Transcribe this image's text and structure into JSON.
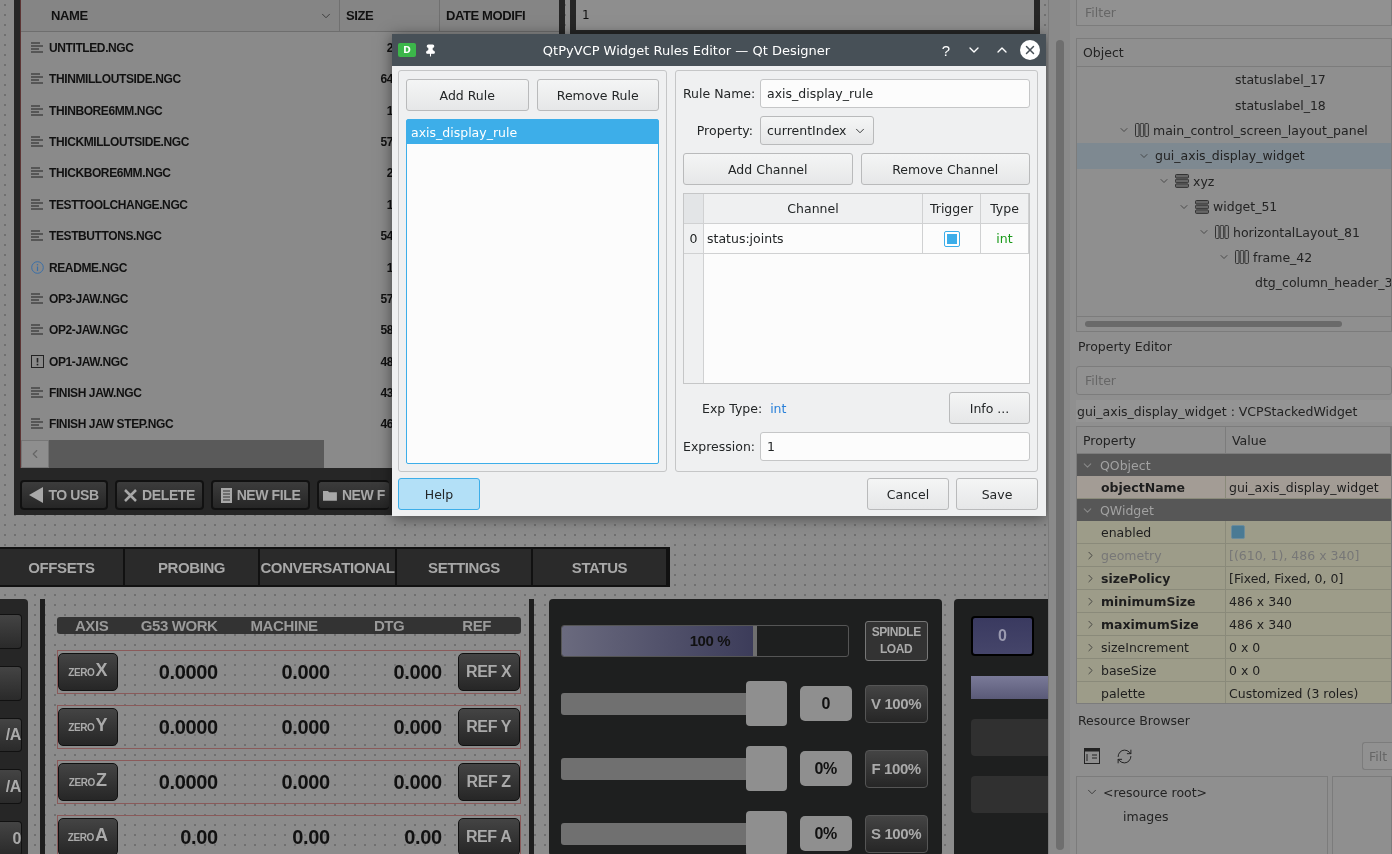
{
  "canvas": {
    "file_browser": {
      "columns": [
        {
          "label": "NAME",
          "sorted": true
        },
        {
          "label": "SIZE",
          "sorted": false
        },
        {
          "label": "DATE MODIFI",
          "sorted": false
        }
      ],
      "rows": [
        {
          "kind": "text",
          "name": "UNTITLED.NGC",
          "size": "2"
        },
        {
          "kind": "text",
          "name": "THINMILLOUTSIDE.NGC",
          "size": "64"
        },
        {
          "kind": "text",
          "name": "THINBORE6MM.NGC",
          "size": "1"
        },
        {
          "kind": "text",
          "name": "THICKMILLOUTSIDE.NGC",
          "size": "57"
        },
        {
          "kind": "text",
          "name": "THICKBORE6MM.NGC",
          "size": "2"
        },
        {
          "kind": "text",
          "name": "TESTTOOLCHANGE.NGC",
          "size": "1"
        },
        {
          "kind": "text",
          "name": "TESTBUTTONS.NGC",
          "size": "54"
        },
        {
          "kind": "info",
          "name": "README.NGC",
          "size": "1"
        },
        {
          "kind": "text",
          "name": "OP3-JAW.NGC",
          "size": "57"
        },
        {
          "kind": "text",
          "name": "OP2-JAW.NGC",
          "size": "58"
        },
        {
          "kind": "warning",
          "name": "OP1-JAW.NGC",
          "size": "48"
        },
        {
          "kind": "text",
          "name": "FINISH JAW.NGC",
          "size": "43"
        },
        {
          "kind": "text",
          "name": "FINISH JAW STEP.NGC",
          "size": "46"
        }
      ],
      "buttons": [
        {
          "kind": "back",
          "label": "TO USB"
        },
        {
          "kind": "delete",
          "label": "DELETE"
        },
        {
          "kind": "file",
          "label": "NEW FILE"
        },
        {
          "kind": "folder",
          "label": "NEW F"
        }
      ]
    },
    "editor_panel": {
      "text": "1"
    },
    "tabs": [
      "OFFSETS",
      "PROBING",
      "CONVERSATIONAL",
      "SETTINGS",
      "STATUS"
    ],
    "side_buttons": [
      {
        "kind": "blank"
      },
      {
        "kind": "blank"
      },
      {
        "kind": "text",
        "label": "/A"
      },
      {
        "kind": "text",
        "label": "/A"
      },
      {
        "kind": "text",
        "label": "0"
      }
    ],
    "dro": {
      "columns": [
        "AXIS",
        "G53 WORK",
        "MACHINE",
        "DTG",
        "REF"
      ],
      "rows": [
        {
          "zero": "ZERO",
          "axis": "X",
          "work": "0.0000",
          "machine": "0.000",
          "dtg": "0.000",
          "ref": "REF X"
        },
        {
          "zero": "ZERO",
          "axis": "Y",
          "work": "0.0000",
          "machine": "0.000",
          "dtg": "0.000",
          "ref": "REF Y"
        },
        {
          "zero": "ZERO",
          "axis": "Z",
          "work": "0.0000",
          "machine": "0.000",
          "dtg": "0.000",
          "ref": "REF Z"
        },
        {
          "zero": "ZERO",
          "axis": "A",
          "work": "0.00",
          "machine": "0.00",
          "dtg": "0.00",
          "ref": "REF A"
        }
      ]
    },
    "spindle": {
      "load": {
        "level": 0.67,
        "text": "100 %",
        "button": "SPINDLE LOAD"
      },
      "sliders": [
        {
          "level": 1,
          "value": "0",
          "button": "V 100%"
        },
        {
          "level": 1,
          "value": "0%",
          "button": "F 100%"
        },
        {
          "level": 1,
          "value": "0%",
          "button": "S 100%"
        }
      ]
    },
    "right_column": {
      "button": "0"
    }
  },
  "dialog": {
    "app_icon": "D",
    "title": "QtPyVCP Widget Rules Editor — Qt Designer",
    "help_glyph": "?",
    "add_rule": "Add Rule",
    "remove_rule": "Remove Rule",
    "rules": [
      {
        "label": "axis_display_rule",
        "selected": true
      }
    ],
    "rule_name_label": "Rule Name:",
    "rule_name": "axis_display_rule",
    "property_label": "Property:",
    "property": "currentIndex",
    "add_channel": "Add Channel",
    "remove_channel": "Remove Channel",
    "channel_columns": [
      "Channel",
      "Trigger",
      "Type"
    ],
    "channels": [
      {
        "index": "0",
        "channel": "status:joints",
        "trigger": true,
        "type": "int"
      }
    ],
    "exp_type_label": "Exp Type:",
    "exp_type": "int",
    "info_button": "Info ...",
    "expression_label": "Expression:",
    "expression": "1",
    "help": "Help",
    "cancel": "Cancel",
    "save": "Save"
  },
  "designer": {
    "object_filter": {
      "placeholder": "Filter"
    },
    "object_inspector": {
      "header": "Object",
      "items": [
        {
          "children": [
            {
              "children": [
                {
                  "children": [
                    {
                      "children": [
                        {
                          "children": [
                            {
                              "label": "statuslabel_17",
                              "selected": false
                            },
                            {
                              "label": "statuslabel_18",
                              "selected": false
                            }
                          ]
                        }
                      ]
                    }
                  ]
                }
              ]
            }
          ]
        },
        {
          "label": "main_control_screen_layout_panel",
          "kind": "columns",
          "expanded": true,
          "selected": false,
          "children": [
            {
              "label": "gui_axis_display_widget",
              "expanded": true,
              "selected": true,
              "children": [
                {
                  "label": "xyz",
                  "kind": "rows",
                  "expanded": true,
                  "selected": false,
                  "children": [
                    {
                      "label": "widget_51",
                      "kind": "rows",
                      "expanded": true,
                      "selected": false,
                      "children": [
                        {
                          "label": "horizontalLayout_81",
                          "kind": "columns",
                          "expanded": true,
                          "selected": false,
                          "children": [
                            {
                              "label": "frame_42",
                              "kind": "columns",
                              "expanded": true,
                              "selected": false,
                              "children": [
                                {
                                  "label": "dtg_column_header_3",
                                  "selected": false
                                }
                              ]
                            }
                          ]
                        }
                      ]
                    }
                  ]
                }
              ]
            }
          ]
        }
      ]
    },
    "property_editor": {
      "title": "Property Editor",
      "filter_placeholder": "Filter",
      "class_label": "gui_axis_display_widget : VCPStackedWidget",
      "columns": [
        "Property",
        "Value"
      ],
      "rows": [
        {
          "kind": "group",
          "name": "QObject",
          "expanded": true
        },
        {
          "kind": "property",
          "name": "objectName",
          "value": "gui_axis_display_widget",
          "modified": true,
          "disabled": false,
          "highlighted": true
        },
        {
          "kind": "group",
          "name": "QWidget",
          "expanded": true
        },
        {
          "kind": "checkbox",
          "name": "enabled",
          "checked": true,
          "modified": false,
          "disabled": false
        },
        {
          "kind": "property",
          "name": "geometry",
          "value": "[(610, 1), 486 x 340]",
          "modified": false,
          "disabled": true,
          "expanded": false
        },
        {
          "kind": "property",
          "name": "sizePolicy",
          "value": "[Fixed, Fixed, 0, 0]",
          "modified": true,
          "disabled": false,
          "expanded": false
        },
        {
          "kind": "property",
          "name": "minimumSize",
          "value": "486 x 340",
          "modified": true,
          "disabled": false,
          "expanded": false
        },
        {
          "kind": "property",
          "name": "maximumSize",
          "value": "486 x 340",
          "modified": true,
          "disabled": false,
          "expanded": false
        },
        {
          "kind": "property",
          "name": "sizeIncrement",
          "value": "0 x 0",
          "modified": false,
          "disabled": false,
          "expanded": false
        },
        {
          "kind": "property",
          "name": "baseSize",
          "value": "0 x 0",
          "modified": false,
          "disabled": false,
          "expanded": false
        },
        {
          "kind": "property",
          "name": "palette",
          "value": "Customized (3 roles)",
          "modified": false,
          "disabled": false
        }
      ]
    },
    "resource_browser": {
      "title": "Resource Browser",
      "filter_placeholder": "Filt",
      "items": [
        {
          "label": "<resource root>",
          "expanded": true,
          "children": [
            {
              "label": "images"
            }
          ]
        }
      ]
    }
  }
}
